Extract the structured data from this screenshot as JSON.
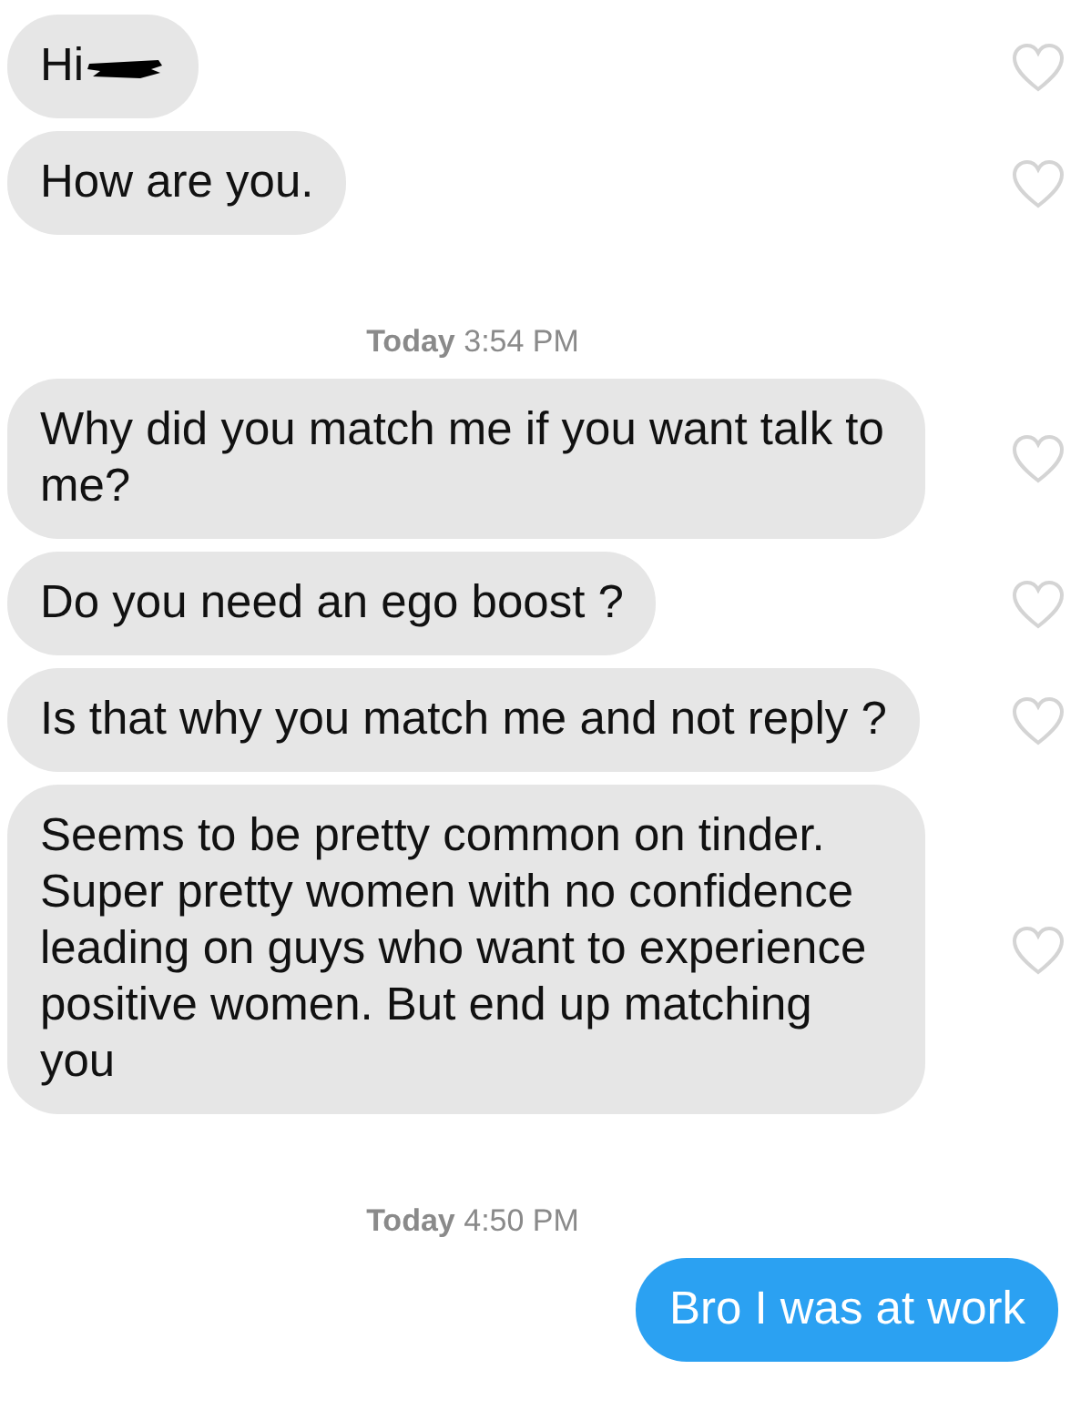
{
  "messages": [
    {
      "kind": "incoming",
      "text": "Hi",
      "redacted": true,
      "liked": false
    },
    {
      "kind": "incoming",
      "text": "How are you.",
      "liked": false
    },
    {
      "kind": "timestamp",
      "day": "Today",
      "time": "3:54 PM"
    },
    {
      "kind": "incoming",
      "text": "Why did you match me if you want talk to me?",
      "liked": false
    },
    {
      "kind": "incoming",
      "text": "Do you need an ego boost ?",
      "liked": false
    },
    {
      "kind": "incoming",
      "text": "Is that why you match me and not reply ?",
      "liked": false
    },
    {
      "kind": "incoming",
      "text": "Seems to be pretty common on tinder. Super pretty women with no confidence leading on guys who want to experience positive women. But end up matching you",
      "liked": false
    },
    {
      "kind": "timestamp",
      "day": "Today",
      "time": "4:50 PM"
    },
    {
      "kind": "outgoing",
      "text": "Bro I was at work"
    }
  ]
}
